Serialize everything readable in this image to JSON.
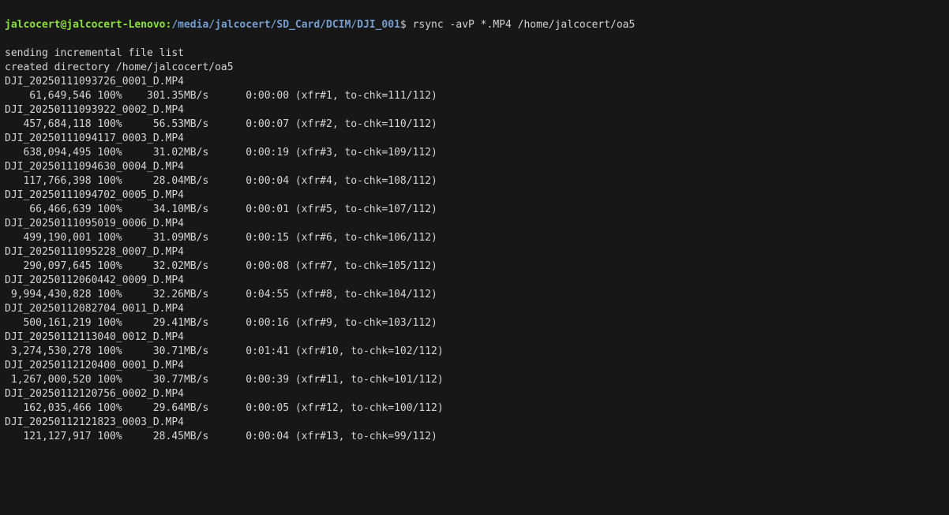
{
  "prompt": {
    "userhost": "jalcocert@jalcocert-Lenovo",
    "path": "/media/jalcocert/SD_Card/DCIM/DJI_001",
    "symbol": "$ ",
    "command": "rsync -avP *.MP4 /home/jalcocert/oa5"
  },
  "header_lines": [
    "sending incremental file list",
    "created directory /home/jalcocert/oa5"
  ],
  "transfers": [
    {
      "file": "DJI_20250111093726_0001_D.MP4",
      "size": "61,649,546",
      "pct": "100%",
      "rate": "301.35MB/s",
      "time": "0:00:00",
      "xfr": 1,
      "tochk": "111/112"
    },
    {
      "file": "DJI_20250111093922_0002_D.MP4",
      "size": "457,684,118",
      "pct": "100%",
      "rate": "56.53MB/s",
      "time": "0:00:07",
      "xfr": 2,
      "tochk": "110/112"
    },
    {
      "file": "DJI_20250111094117_0003_D.MP4",
      "size": "638,094,495",
      "pct": "100%",
      "rate": "31.02MB/s",
      "time": "0:00:19",
      "xfr": 3,
      "tochk": "109/112"
    },
    {
      "file": "DJI_20250111094630_0004_D.MP4",
      "size": "117,766,398",
      "pct": "100%",
      "rate": "28.04MB/s",
      "time": "0:00:04",
      "xfr": 4,
      "tochk": "108/112"
    },
    {
      "file": "DJI_20250111094702_0005_D.MP4",
      "size": "66,466,639",
      "pct": "100%",
      "rate": "34.10MB/s",
      "time": "0:00:01",
      "xfr": 5,
      "tochk": "107/112"
    },
    {
      "file": "DJI_20250111095019_0006_D.MP4",
      "size": "499,190,001",
      "pct": "100%",
      "rate": "31.09MB/s",
      "time": "0:00:15",
      "xfr": 6,
      "tochk": "106/112"
    },
    {
      "file": "DJI_20250111095228_0007_D.MP4",
      "size": "290,097,645",
      "pct": "100%",
      "rate": "32.02MB/s",
      "time": "0:00:08",
      "xfr": 7,
      "tochk": "105/112"
    },
    {
      "file": "DJI_20250112060442_0009_D.MP4",
      "size": "9,994,430,828",
      "pct": "100%",
      "rate": "32.26MB/s",
      "time": "0:04:55",
      "xfr": 8,
      "tochk": "104/112"
    },
    {
      "file": "DJI_20250112082704_0011_D.MP4",
      "size": "500,161,219",
      "pct": "100%",
      "rate": "29.41MB/s",
      "time": "0:00:16",
      "xfr": 9,
      "tochk": "103/112"
    },
    {
      "file": "DJI_20250112113040_0012_D.MP4",
      "size": "3,274,530,278",
      "pct": "100%",
      "rate": "30.71MB/s",
      "time": "0:01:41",
      "xfr": 10,
      "tochk": "102/112"
    },
    {
      "file": "DJI_20250112120400_0001_D.MP4",
      "size": "1,267,000,520",
      "pct": "100%",
      "rate": "30.77MB/s",
      "time": "0:00:39",
      "xfr": 11,
      "tochk": "101/112"
    },
    {
      "file": "DJI_20250112120756_0002_D.MP4",
      "size": "162,035,466",
      "pct": "100%",
      "rate": "29.64MB/s",
      "time": "0:00:05",
      "xfr": 12,
      "tochk": "100/112"
    },
    {
      "file": "DJI_20250112121823_0003_D.MP4",
      "size": "121,127,917",
      "pct": "100%",
      "rate": "28.45MB/s",
      "time": "0:00:04",
      "xfr": 13,
      "tochk": "99/112"
    }
  ],
  "columns": {
    "size_width": 14,
    "rate_stop": 33,
    "time_stop": 46
  }
}
